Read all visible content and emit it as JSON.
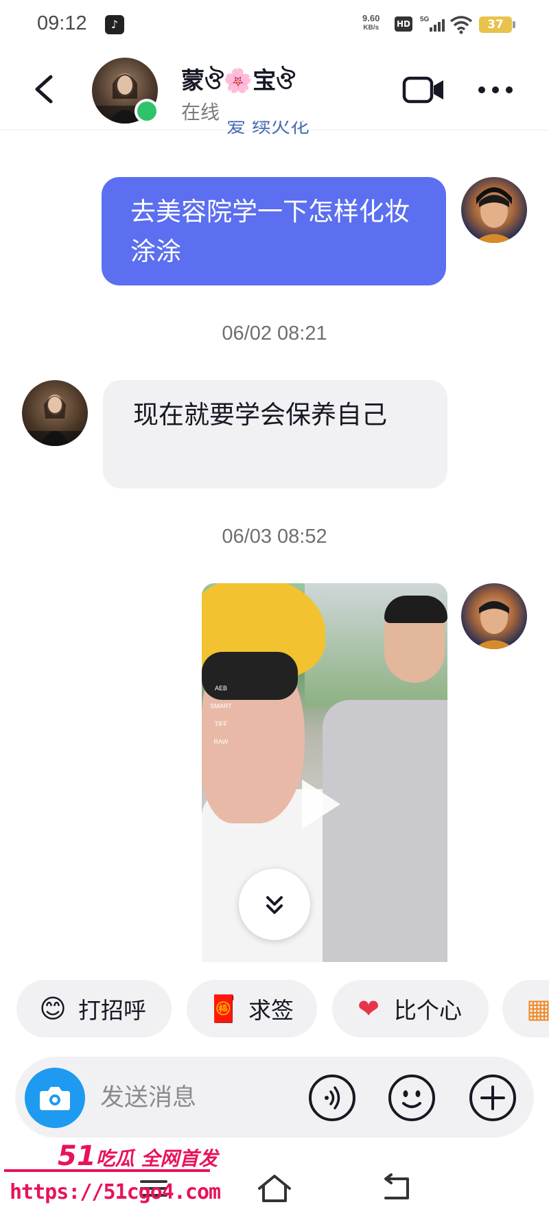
{
  "status_bar": {
    "time": "09:12",
    "net_speed_value": "9.60",
    "net_speed_unit": "KB/s",
    "hd_label": "HD",
    "network_label": "5G",
    "battery": "37",
    "app_icon": "tiktok-icon"
  },
  "header": {
    "contact_name": "蒙ঔ🌸宝ঔ",
    "presence": "在线",
    "icons": [
      "back-icon",
      "video-call-icon",
      "more-icon"
    ]
  },
  "thread": {
    "cut_off_text": "爱 续火花",
    "messages": [
      {
        "from": "me",
        "text": "去美容院学一下怎样化妆涂涂"
      },
      {
        "timestamp": "06/02 08:21"
      },
      {
        "from": "contact",
        "text": " 现在就要学会保养自己"
      },
      {
        "timestamp": "06/03 08:52"
      },
      {
        "from": "me",
        "type": "video",
        "camera_overlay": [
          "AEB",
          "SMART",
          "TIFF",
          "RAW"
        ]
      }
    ]
  },
  "quick_replies": [
    {
      "label": "打招呼",
      "icon": "wave-smile-emoji"
    },
    {
      "label": "求签",
      "icon": "fortune-sticks-emoji"
    },
    {
      "label": "比个心",
      "icon": "heart-emoji"
    },
    {
      "label": "",
      "icon": "group-photo-emoji"
    }
  ],
  "composer": {
    "placeholder": "发送消息",
    "icons": [
      "camera-icon",
      "voice-icon",
      "emoji-icon",
      "plus-icon"
    ]
  },
  "watermark": {
    "line1_number": "51",
    "line1_text": "吃瓜 全网首发",
    "url": "https://51cgo4.com"
  },
  "colors": {
    "outgoing_bubble": "#5b6ff0",
    "incoming_bubble": "#f1f1f3",
    "online": "#2ec36b",
    "camera_button": "#1e9bf0",
    "watermark": "#e8125c"
  }
}
